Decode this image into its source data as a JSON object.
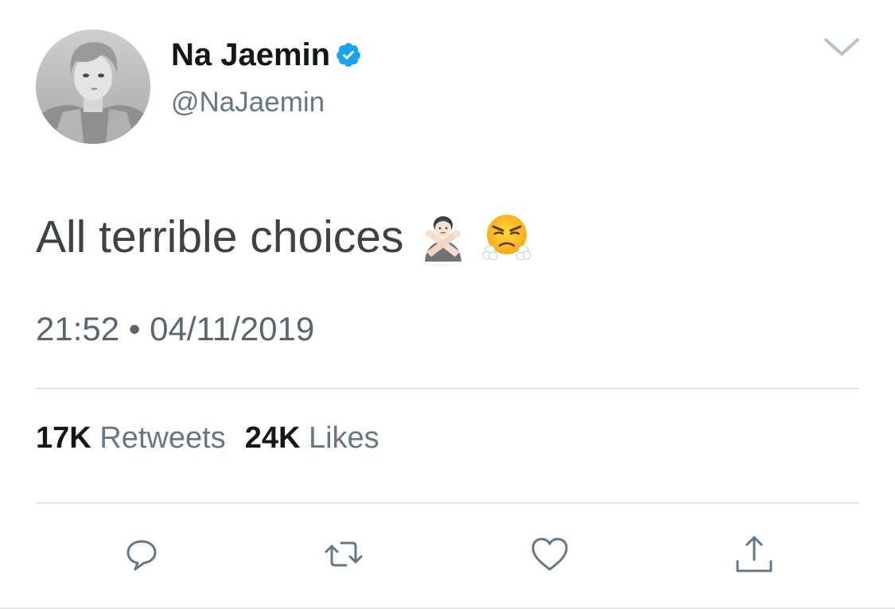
{
  "user": {
    "display_name": "Na Jaemin",
    "handle": "@NaJaemin",
    "verified": true,
    "avatar": "grayscale-profile-photo"
  },
  "tweet": {
    "text": "All terrible choices",
    "emojis": [
      "person-gesturing-no-emoji",
      "face-with-steam-from-nose-emoji"
    ],
    "timestamp": "21:52 • 04/11/2019"
  },
  "stats": {
    "retweets_count": "17K",
    "retweets_label": "Retweets",
    "likes_count": "24K",
    "likes_label": "Likes"
  },
  "actions": {
    "icons": [
      "reply-icon",
      "retweet-icon",
      "like-icon",
      "share-icon"
    ]
  },
  "colors": {
    "verified_blue": "#1da1f2",
    "secondary_text": "#657786",
    "icon_gray": "#657786",
    "divider": "#cfd5da"
  }
}
